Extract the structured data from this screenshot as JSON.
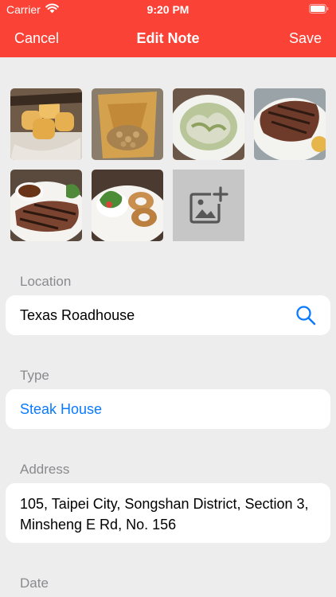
{
  "status_bar": {
    "carrier": "Carrier",
    "time": "9:20 PM"
  },
  "nav": {
    "cancel": "Cancel",
    "title": "Edit Note",
    "save": "Save"
  },
  "photos": {
    "items": [
      "bread-rolls-photo",
      "peanuts-basket-photo",
      "caesar-salad-photo",
      "grilled-steak-photo",
      "steak-with-sauce-photo",
      "onion-rings-and-salad-photo"
    ],
    "add_icon": "add-photo-icon"
  },
  "location": {
    "label": "Location",
    "value": "Texas Roadhouse",
    "icon": "search-icon"
  },
  "type": {
    "label": "Type",
    "value": "Steak House"
  },
  "address": {
    "label": "Address",
    "value": "105, Taipei City, Songshan District, Section 3, Minsheng E Rd, No. 156"
  },
  "date": {
    "label": "Date"
  },
  "colors": {
    "nav_bar": "#fb4236",
    "accent_blue": "#0a7aff",
    "background": "#ededed",
    "label_gray": "#8a8a8e"
  }
}
